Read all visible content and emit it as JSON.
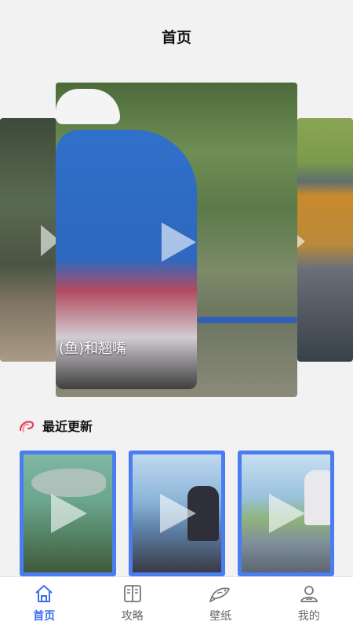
{
  "header": {
    "title": "首页"
  },
  "carousel": {
    "main_caption": "(鱼)和翘嘴"
  },
  "section": {
    "title": "最近更新"
  },
  "tabs": [
    {
      "label": "首页",
      "icon": "home-icon",
      "active": true
    },
    {
      "label": "攻略",
      "icon": "book-icon",
      "active": false
    },
    {
      "label": "壁纸",
      "icon": "fish-icon",
      "active": false
    },
    {
      "label": "我的",
      "icon": "user-icon",
      "active": false
    }
  ],
  "colors": {
    "accent": "#3a6ff2",
    "thumb_border": "#4a7df0",
    "section_icon": "#e23b56"
  }
}
